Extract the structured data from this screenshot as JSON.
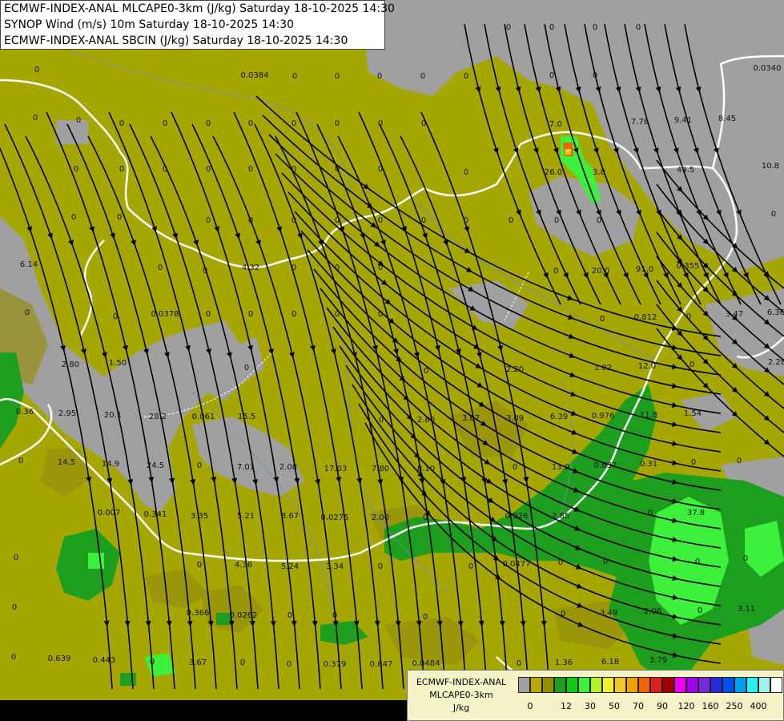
{
  "header": {
    "line1": "ECMWF-INDEX-ANAL MLCAPE0-3km (J/kg) Saturday 18-10-2025 14:30",
    "line2": "SYNOP Wind (m/s) 10m Saturday 18-10-2025 14:30",
    "line3": "ECMWF-INDEX-ANAL SBCIN (J/kg) Saturday 18-10-2025 14:30"
  },
  "legend": {
    "title1": "ECMWF-INDEX-ANAL",
    "title2": "MLCAPE0-3km",
    "unit": "J/kg",
    "ticks": [
      "0",
      "12",
      "30",
      "50",
      "70",
      "90",
      "120",
      "160",
      "250",
      "400"
    ],
    "colors": [
      "#a0a0a0",
      "#bba800",
      "#8f8f00",
      "#1e9e1e",
      "#14c814",
      "#3cf03c",
      "#b4f028",
      "#f0f028",
      "#f0c828",
      "#f0a000",
      "#f06400",
      "#dc1e1e",
      "#a00000",
      "#f000f0",
      "#a000f0",
      "#7828dc",
      "#2828dc",
      "#0050f0",
      "#00a0f0",
      "#28f0f0",
      "#a0f0f0",
      "#ffffff"
    ]
  },
  "colors": {
    "background": "#a6a600",
    "no_cape": "#a0a0a0",
    "low_cape": "#1e9e1e",
    "mid_cape": "#28e028",
    "streamline": "#000000",
    "border": "#ffffff",
    "river": "#6f8fbf"
  },
  "sbcin_labels": [
    "0",
    "0",
    "0",
    "0.0384",
    "0",
    "0",
    "0",
    "0",
    "0",
    "0",
    "0",
    "0",
    "0",
    "0",
    "0",
    "0.0340",
    "0",
    "0",
    "0",
    "0",
    "0",
    "0",
    "0",
    "7.0",
    "0",
    "7.78",
    "9.41",
    "8.45",
    "0",
    "0",
    "0",
    "0",
    "0",
    "0",
    "0",
    "0",
    "26.0",
    "3.8",
    "0",
    "49.5",
    "10.8",
    "0",
    "0",
    "0",
    "0",
    "0",
    "0",
    "0",
    "0",
    "0",
    "0",
    "0",
    "0",
    "0",
    "6.14",
    "0",
    "0",
    "4.32",
    "0",
    "0",
    "0",
    "0",
    "20.0",
    "91.0",
    "0.355",
    "0",
    "0",
    "0.0378",
    "0",
    "0",
    "0",
    "0",
    "0",
    "0",
    "0.812",
    "0",
    "3.47",
    "6.36",
    "2.80",
    "1.50",
    "0",
    "0",
    "2.20",
    "1.02",
    "12.0",
    "0",
    "2.28",
    "0.36",
    "2.95",
    "20.1",
    "28.2",
    "0.061",
    "15.5",
    "0",
    "2.80",
    "3.67",
    "3.09",
    "6.39",
    "0.976",
    "11.8",
    "1.54",
    "0",
    "14.5",
    "14.9",
    "24.5",
    "0",
    "7.01",
    "2.08",
    "17.03",
    "7.80",
    "8.10",
    "0",
    "13.0",
    "0.637",
    "0.31",
    "0",
    "0",
    "0.007",
    "0.341",
    "3.35",
    "5.21",
    "8.67",
    "0.0275",
    "2.00",
    "0",
    "0.926",
    "2.85",
    "0",
    "37.8",
    "0",
    "0",
    "4.36",
    "5.24",
    "3.34",
    "0",
    "0",
    "0.0477",
    "0",
    "0",
    "0",
    "0",
    "0",
    "0.366",
    "0.0262",
    "0",
    "0",
    "0",
    "0",
    "3.49",
    "2.06",
    "0",
    "3.11",
    "0",
    "0.639",
    "0.443",
    "0",
    "3.67",
    "0",
    "0",
    "0.379",
    "0.647",
    "0.0484",
    "0",
    "1.36",
    "6.18",
    "3.79",
    "13.2"
  ]
}
